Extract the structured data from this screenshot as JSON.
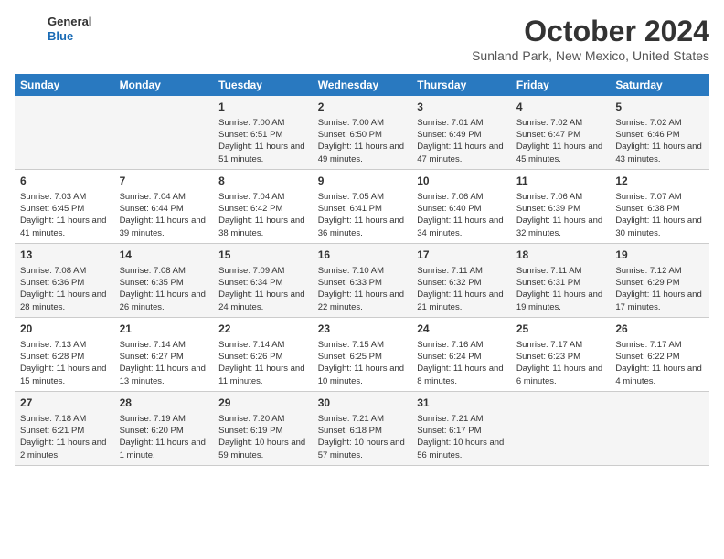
{
  "header": {
    "logo_line1": "General",
    "logo_line2": "Blue",
    "month": "October 2024",
    "location": "Sunland Park, New Mexico, United States"
  },
  "days_of_week": [
    "Sunday",
    "Monday",
    "Tuesday",
    "Wednesday",
    "Thursday",
    "Friday",
    "Saturday"
  ],
  "weeks": [
    [
      {
        "day": "",
        "info": ""
      },
      {
        "day": "",
        "info": ""
      },
      {
        "day": "1",
        "info": "Sunrise: 7:00 AM\nSunset: 6:51 PM\nDaylight: 11 hours and 51 minutes."
      },
      {
        "day": "2",
        "info": "Sunrise: 7:00 AM\nSunset: 6:50 PM\nDaylight: 11 hours and 49 minutes."
      },
      {
        "day": "3",
        "info": "Sunrise: 7:01 AM\nSunset: 6:49 PM\nDaylight: 11 hours and 47 minutes."
      },
      {
        "day": "4",
        "info": "Sunrise: 7:02 AM\nSunset: 6:47 PM\nDaylight: 11 hours and 45 minutes."
      },
      {
        "day": "5",
        "info": "Sunrise: 7:02 AM\nSunset: 6:46 PM\nDaylight: 11 hours and 43 minutes."
      }
    ],
    [
      {
        "day": "6",
        "info": "Sunrise: 7:03 AM\nSunset: 6:45 PM\nDaylight: 11 hours and 41 minutes."
      },
      {
        "day": "7",
        "info": "Sunrise: 7:04 AM\nSunset: 6:44 PM\nDaylight: 11 hours and 39 minutes."
      },
      {
        "day": "8",
        "info": "Sunrise: 7:04 AM\nSunset: 6:42 PM\nDaylight: 11 hours and 38 minutes."
      },
      {
        "day": "9",
        "info": "Sunrise: 7:05 AM\nSunset: 6:41 PM\nDaylight: 11 hours and 36 minutes."
      },
      {
        "day": "10",
        "info": "Sunrise: 7:06 AM\nSunset: 6:40 PM\nDaylight: 11 hours and 34 minutes."
      },
      {
        "day": "11",
        "info": "Sunrise: 7:06 AM\nSunset: 6:39 PM\nDaylight: 11 hours and 32 minutes."
      },
      {
        "day": "12",
        "info": "Sunrise: 7:07 AM\nSunset: 6:38 PM\nDaylight: 11 hours and 30 minutes."
      }
    ],
    [
      {
        "day": "13",
        "info": "Sunrise: 7:08 AM\nSunset: 6:36 PM\nDaylight: 11 hours and 28 minutes."
      },
      {
        "day": "14",
        "info": "Sunrise: 7:08 AM\nSunset: 6:35 PM\nDaylight: 11 hours and 26 minutes."
      },
      {
        "day": "15",
        "info": "Sunrise: 7:09 AM\nSunset: 6:34 PM\nDaylight: 11 hours and 24 minutes."
      },
      {
        "day": "16",
        "info": "Sunrise: 7:10 AM\nSunset: 6:33 PM\nDaylight: 11 hours and 22 minutes."
      },
      {
        "day": "17",
        "info": "Sunrise: 7:11 AM\nSunset: 6:32 PM\nDaylight: 11 hours and 21 minutes."
      },
      {
        "day": "18",
        "info": "Sunrise: 7:11 AM\nSunset: 6:31 PM\nDaylight: 11 hours and 19 minutes."
      },
      {
        "day": "19",
        "info": "Sunrise: 7:12 AM\nSunset: 6:29 PM\nDaylight: 11 hours and 17 minutes."
      }
    ],
    [
      {
        "day": "20",
        "info": "Sunrise: 7:13 AM\nSunset: 6:28 PM\nDaylight: 11 hours and 15 minutes."
      },
      {
        "day": "21",
        "info": "Sunrise: 7:14 AM\nSunset: 6:27 PM\nDaylight: 11 hours and 13 minutes."
      },
      {
        "day": "22",
        "info": "Sunrise: 7:14 AM\nSunset: 6:26 PM\nDaylight: 11 hours and 11 minutes."
      },
      {
        "day": "23",
        "info": "Sunrise: 7:15 AM\nSunset: 6:25 PM\nDaylight: 11 hours and 10 minutes."
      },
      {
        "day": "24",
        "info": "Sunrise: 7:16 AM\nSunset: 6:24 PM\nDaylight: 11 hours and 8 minutes."
      },
      {
        "day": "25",
        "info": "Sunrise: 7:17 AM\nSunset: 6:23 PM\nDaylight: 11 hours and 6 minutes."
      },
      {
        "day": "26",
        "info": "Sunrise: 7:17 AM\nSunset: 6:22 PM\nDaylight: 11 hours and 4 minutes."
      }
    ],
    [
      {
        "day": "27",
        "info": "Sunrise: 7:18 AM\nSunset: 6:21 PM\nDaylight: 11 hours and 2 minutes."
      },
      {
        "day": "28",
        "info": "Sunrise: 7:19 AM\nSunset: 6:20 PM\nDaylight: 11 hours and 1 minute."
      },
      {
        "day": "29",
        "info": "Sunrise: 7:20 AM\nSunset: 6:19 PM\nDaylight: 10 hours and 59 minutes."
      },
      {
        "day": "30",
        "info": "Sunrise: 7:21 AM\nSunset: 6:18 PM\nDaylight: 10 hours and 57 minutes."
      },
      {
        "day": "31",
        "info": "Sunrise: 7:21 AM\nSunset: 6:17 PM\nDaylight: 10 hours and 56 minutes."
      },
      {
        "day": "",
        "info": ""
      },
      {
        "day": "",
        "info": ""
      }
    ]
  ]
}
